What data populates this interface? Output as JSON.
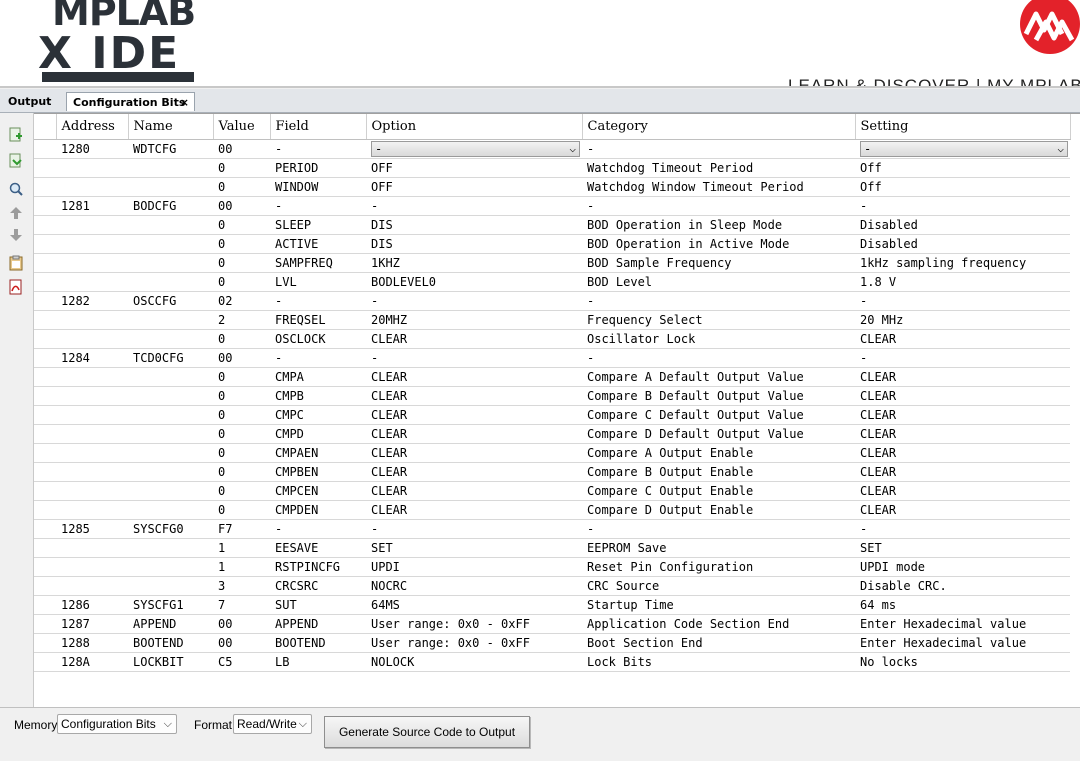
{
  "banner": {
    "logo_line1": "MPLAB",
    "logo_line2": "X IDE",
    "links": "LEARN & DISCOVER  |  MY MPLAB"
  },
  "tabs": [
    {
      "label": "Output"
    },
    {
      "label": "Configuration Bits",
      "close": "×"
    }
  ],
  "toolbar_icons": [
    "read-config-icon",
    "program-config-icon",
    "search-icon",
    "move-up-icon",
    "move-down-icon",
    "clipboard-icon",
    "pdf-export-icon"
  ],
  "table": {
    "headers": [
      "Address",
      "Name",
      "Value",
      "Field",
      "Option",
      "Category",
      "Setting"
    ],
    "rows": [
      {
        "address": "1280",
        "name": "WDTCFG",
        "value": "00",
        "field": "-",
        "option": "-",
        "category": "-",
        "setting": "-",
        "combo": true
      },
      {
        "address": "",
        "name": "",
        "value": "0",
        "field": "PERIOD",
        "option": "OFF",
        "category": "Watchdog Timeout Period",
        "setting": "Off"
      },
      {
        "address": "",
        "name": "",
        "value": "0",
        "field": "WINDOW",
        "option": "OFF",
        "category": "Watchdog Window Timeout Period",
        "setting": "Off"
      },
      {
        "address": "1281",
        "name": "BODCFG",
        "value": "00",
        "field": "-",
        "option": "-",
        "category": "-",
        "setting": "-"
      },
      {
        "address": "",
        "name": "",
        "value": "0",
        "field": "SLEEP",
        "option": "DIS",
        "category": "BOD Operation in Sleep Mode",
        "setting": "Disabled"
      },
      {
        "address": "",
        "name": "",
        "value": "0",
        "field": "ACTIVE",
        "option": "DIS",
        "category": "BOD Operation in Active Mode",
        "setting": "Disabled"
      },
      {
        "address": "",
        "name": "",
        "value": "0",
        "field": "SAMPFREQ",
        "option": "1KHZ",
        "category": "BOD Sample Frequency",
        "setting": "1kHz sampling frequency"
      },
      {
        "address": "",
        "name": "",
        "value": "0",
        "field": "LVL",
        "option": "BODLEVEL0",
        "category": "BOD Level",
        "setting": "1.8 V"
      },
      {
        "address": "1282",
        "name": "OSCCFG",
        "value": "02",
        "field": "-",
        "option": "-",
        "category": "-",
        "setting": "-"
      },
      {
        "address": "",
        "name": "",
        "value": "2",
        "field": "FREQSEL",
        "option": "20MHZ",
        "category": "Frequency Select",
        "setting": "20 MHz"
      },
      {
        "address": "",
        "name": "",
        "value": "0",
        "field": "OSCLOCK",
        "option": "CLEAR",
        "category": "Oscillator Lock",
        "setting": "CLEAR"
      },
      {
        "address": "1284",
        "name": "TCD0CFG",
        "value": "00",
        "field": "-",
        "option": "-",
        "category": "-",
        "setting": "-"
      },
      {
        "address": "",
        "name": "",
        "value": "0",
        "field": "CMPA",
        "option": "CLEAR",
        "category": "Compare A Default Output Value",
        "setting": "CLEAR"
      },
      {
        "address": "",
        "name": "",
        "value": "0",
        "field": "CMPB",
        "option": "CLEAR",
        "category": "Compare B Default Output Value",
        "setting": "CLEAR"
      },
      {
        "address": "",
        "name": "",
        "value": "0",
        "field": "CMPC",
        "option": "CLEAR",
        "category": "Compare C Default Output Value",
        "setting": "CLEAR"
      },
      {
        "address": "",
        "name": "",
        "value": "0",
        "field": "CMPD",
        "option": "CLEAR",
        "category": "Compare D Default Output Value",
        "setting": "CLEAR"
      },
      {
        "address": "",
        "name": "",
        "value": "0",
        "field": "CMPAEN",
        "option": "CLEAR",
        "category": "Compare A Output Enable",
        "setting": "CLEAR"
      },
      {
        "address": "",
        "name": "",
        "value": "0",
        "field": "CMPBEN",
        "option": "CLEAR",
        "category": "Compare B Output Enable",
        "setting": "CLEAR"
      },
      {
        "address": "",
        "name": "",
        "value": "0",
        "field": "CMPCEN",
        "option": "CLEAR",
        "category": "Compare C Output Enable",
        "setting": "CLEAR"
      },
      {
        "address": "",
        "name": "",
        "value": "0",
        "field": "CMPDEN",
        "option": "CLEAR",
        "category": "Compare D Output Enable",
        "setting": "CLEAR"
      },
      {
        "address": "1285",
        "name": "SYSCFG0",
        "value": "F7",
        "field": "-",
        "option": "-",
        "category": "-",
        "setting": "-"
      },
      {
        "address": "",
        "name": "",
        "value": "1",
        "field": "EESAVE",
        "option": "SET",
        "category": "EEPROM Save",
        "setting": "SET"
      },
      {
        "address": "",
        "name": "",
        "value": "1",
        "field": "RSTPINCFG",
        "option": "UPDI",
        "category": "Reset Pin Configuration",
        "setting": "UPDI mode"
      },
      {
        "address": "",
        "name": "",
        "value": "3",
        "field": "CRCSRC",
        "option": "NOCRC",
        "category": "CRC Source",
        "setting": "Disable CRC."
      },
      {
        "address": "1286",
        "name": "SYSCFG1",
        "value": "7",
        "field": "SUT",
        "option": "64MS",
        "category": "Startup Time",
        "setting": "64 ms"
      },
      {
        "address": "1287",
        "name": "APPEND",
        "value": "00",
        "field": "APPEND",
        "option": "User range:  0x0 - 0xFF",
        "category": "Application Code Section End",
        "setting": "Enter Hexadecimal value"
      },
      {
        "address": "1288",
        "name": "BOOTEND",
        "value": "00",
        "field": "BOOTEND",
        "option": "User range:  0x0 - 0xFF",
        "category": "Boot Section End",
        "setting": "Enter Hexadecimal value"
      },
      {
        "address": "128A",
        "name": "LOCKBIT",
        "value": "C5",
        "field": "LB",
        "option": "NOLOCK",
        "category": "Lock Bits",
        "setting": "No locks"
      }
    ]
  },
  "bottom": {
    "memory_label": "Memory",
    "memory_value": "Configuration Bits",
    "format_label": "Format",
    "format_value": "Read/Write",
    "generate_label": "Generate Source Code to Output"
  },
  "colors": {
    "brand_red": "#e3222a",
    "logo_dark": "#2b3138"
  }
}
